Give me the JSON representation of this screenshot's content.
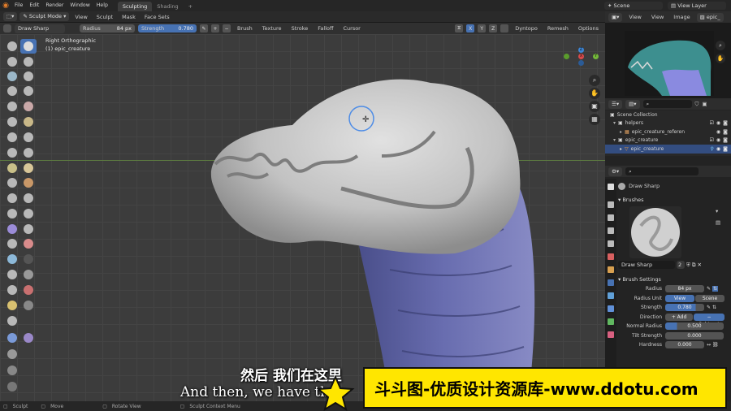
{
  "topbar": {
    "menus": [
      "File",
      "Edit",
      "Render",
      "Window",
      "Help"
    ],
    "workspace_tabs": [
      "Sculpting",
      "Shading"
    ],
    "add_tab": "+",
    "scene_label": "Scene",
    "view_layer_label": "View Layer"
  },
  "header": {
    "mode": "Sculpt Mode",
    "menus": [
      "View",
      "Sculpt",
      "Mask",
      "Face Sets"
    ],
    "axes": [
      "X",
      "Y",
      "Z"
    ],
    "dyntopo": "Dyntopo",
    "remesh": "Remesh",
    "options": "Options"
  },
  "tool_settings": {
    "brush_name": "Draw Sharp",
    "radius_label": "Radius",
    "radius_value": "84 px",
    "strength_label": "Strength",
    "strength_value": "0.780",
    "menus": [
      "Brush",
      "Texture",
      "Stroke",
      "Falloff",
      "Cursor"
    ]
  },
  "viewport": {
    "view_name": "Right Orthographic",
    "object_name": "(1) epic_creature",
    "gizmo_axes": [
      "Z",
      "Y",
      "X"
    ]
  },
  "image_editor": {
    "menus": [
      "View",
      "View",
      "Image"
    ],
    "image_name": "epic_"
  },
  "outliner": {
    "rows": [
      {
        "label": "Scene Collection",
        "indent": 0
      },
      {
        "label": "helpers",
        "indent": 1
      },
      {
        "label": "epic_creature_referen",
        "indent": 2
      },
      {
        "label": "epic_creature",
        "indent": 1
      },
      {
        "label": "epic_creature",
        "indent": 2,
        "selected": true
      }
    ]
  },
  "properties": {
    "brush_title": "Draw Sharp",
    "brushes_section": "Brushes",
    "brush_field_name": "Draw Sharp",
    "brush_users": "2",
    "brush_settings_section": "Brush Settings",
    "rows": [
      {
        "label": "Radius",
        "value": "84 px"
      },
      {
        "label": "Radius Unit",
        "value": "View",
        "alt": "Scene"
      },
      {
        "label": "Strength",
        "value": "0.780"
      },
      {
        "label": "Direction",
        "value": "+ Add",
        "alt": "− Subtract"
      },
      {
        "label": "Normal Radius",
        "value": "0.500"
      },
      {
        "label": "Tilt Strength",
        "value": "0.000"
      },
      {
        "label": "Hardness",
        "value": "0.000"
      }
    ]
  },
  "status_bar": {
    "items": [
      "Sculpt",
      "Move",
      "Rotate View",
      "Sculpt Context Menu"
    ]
  },
  "subtitles": {
    "cn": "然后 我们在这里",
    "en": "And then, we have the"
  },
  "banner": {
    "text": "斗斗图-优质设计资源库-www.ddotu.com"
  },
  "colors": {
    "accent_blue": "#4772b3",
    "banner_yellow": "#ffe600",
    "sculpt_grey": "#cfcfcf",
    "neck_purple": "#6a6fb5"
  }
}
